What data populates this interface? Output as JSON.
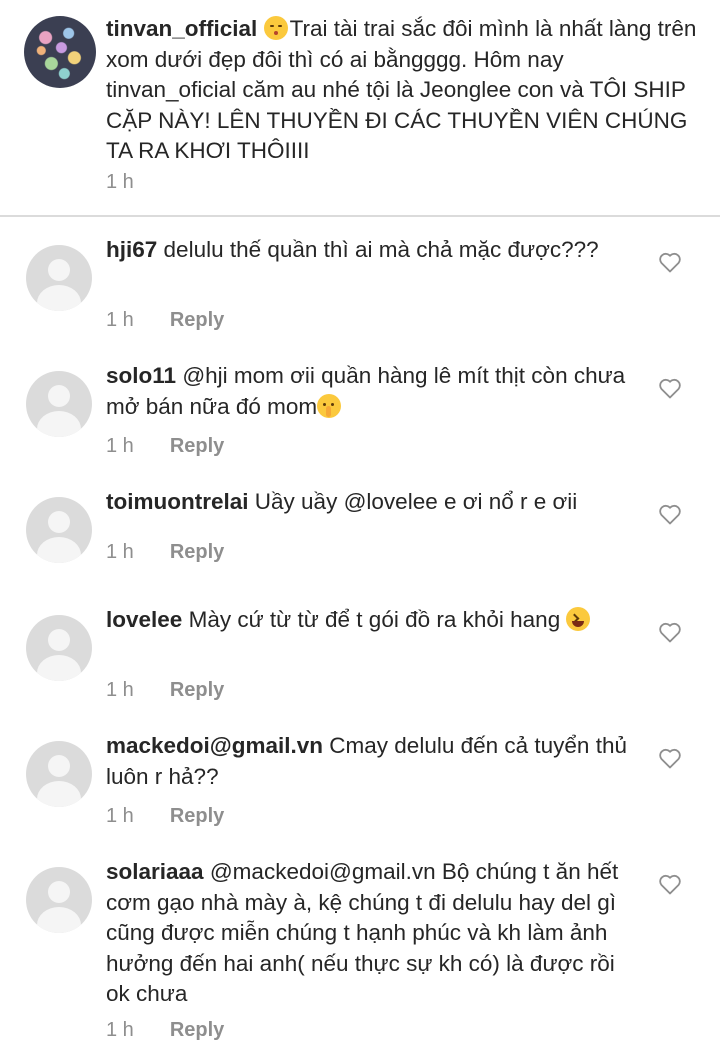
{
  "caption": {
    "username": "tinvan_official",
    "text": "Trai tài trai sắc đôi mình là nhất làng trên xom dưới đẹp đôi thì có ai bằngggg. Hôm nay tinvan_oficial căm au nhé tội là Jeonglee con và TÔI SHIP CẶP NÀY! LÊN THUYỀN ĐI CÁC THUYỀN VIÊN CHÚNG TA RA KHƠI THÔIIII",
    "emoji": "kissing-face-emoji",
    "time": "1 h"
  },
  "reply_label": "Reply",
  "comments": [
    {
      "username": "hji67",
      "text": "delulu thế quần thì ai mà chả mặc được???",
      "time": "1 h",
      "emoji": ""
    },
    {
      "username": "solo11",
      "text": "@hji mom ơii quần hàng lê mít thịt còn chưa mở bán nữa đó mom",
      "time": "1 h",
      "emoji": "shushing-face-emoji"
    },
    {
      "username": "toimuontrelai",
      "text": "Uầy uầy @lovelee e ơi nổ r e ơii",
      "time": "1 h",
      "emoji": ""
    },
    {
      "username": "lovelee",
      "text": "Mày cứ từ từ để t gói đồ ra khỏi hang",
      "time": "1 h",
      "emoji": "laughing-face-emoji"
    },
    {
      "username": "mackedoi@gmail.vn",
      "text": "Cmay delulu đến cả tuyển thủ luôn r hả??",
      "time": "1 h",
      "emoji": ""
    },
    {
      "username": "solariaaa",
      "text": "@mackedoi@gmail.vn Bộ chúng t ăn hết cơm gạo nhà mày à, kệ chúng t đi delulu hay del gì cũng được miễn chúng t hạnh phúc và kh làm ảnh hưởng đến hai anh( nếu thực sự kh có) là được rồi ok chưa",
      "time": "1 h",
      "emoji": ""
    }
  ]
}
